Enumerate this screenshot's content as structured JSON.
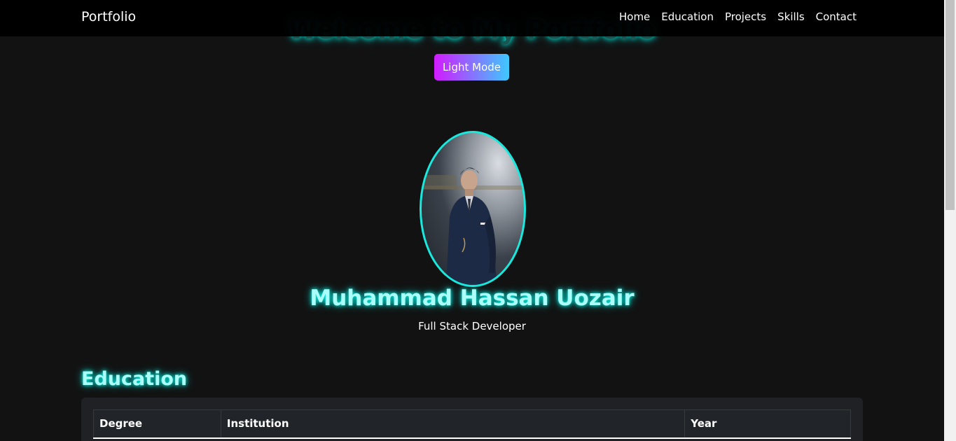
{
  "navbar": {
    "brand": "Portfolio",
    "links": [
      "Home",
      "Education",
      "Projects",
      "Skills",
      "Contact"
    ]
  },
  "hero": {
    "title": "Welcome to My Portfolio",
    "mode_button_label": "Light Mode"
  },
  "profile": {
    "name": "Muhammad Hassan Uozair",
    "role": "Full Stack Developer"
  },
  "education": {
    "title": "Education",
    "table_headers": [
      "Degree",
      "Institution",
      "Year"
    ]
  },
  "colors": {
    "background": "#121212",
    "accent_glow": "#00fff0",
    "button_gradient_start": "#d21bff",
    "button_gradient_end": "#3ec8ff"
  }
}
